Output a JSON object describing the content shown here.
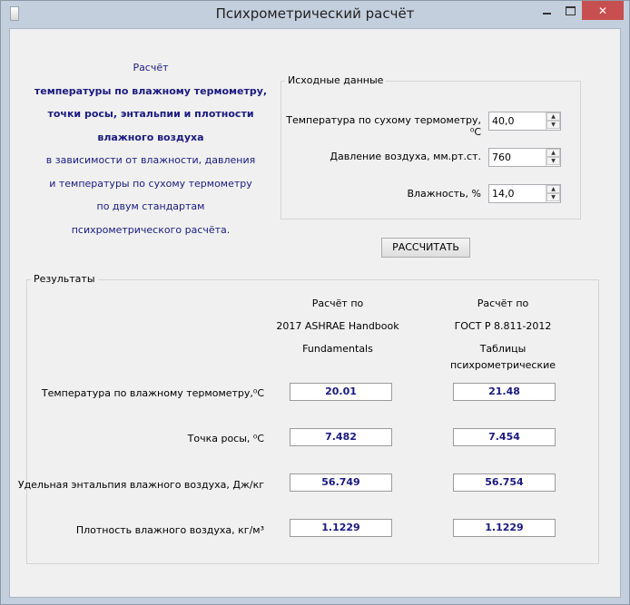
{
  "window": {
    "title": "Психрометрический расчёт"
  },
  "intro": {
    "line1": "Расчёт",
    "line2": "температуры по влажному термометру,",
    "line3": "точки росы, энтальпии и плотности",
    "line4": "влажного воздуха",
    "line5": "в зависимости от влажности, давления",
    "line6": "и температуры по сухому термометру",
    "line7": "по двум стандартам",
    "line8": "психрометрического расчёта."
  },
  "inputs": {
    "group_label": "Исходные данные",
    "dry_temp": {
      "label": "Температура по сухому термометру, ⁰С",
      "value": "40,0"
    },
    "pressure": {
      "label": "Давление воздуха, мм.рт.ст.",
      "value": "760"
    },
    "humidity": {
      "label": "Влажность, %",
      "value": "14,0"
    }
  },
  "calculate_button": "РАССЧИТАТЬ",
  "results": {
    "group_label": "Результаты",
    "col1": {
      "line1": "Расчёт по",
      "line2": "2017 ASHRAE Handbook",
      "line3": "Fundamentals"
    },
    "col2": {
      "line1": "Расчёт по",
      "line2": "ГОСТ Р 8.811-2012",
      "line3": "Таблицы психрометрические"
    },
    "rows": [
      {
        "label": "Температура по влажному термометру,⁰С",
        "ashrae": "20.01",
        "gost": "21.48"
      },
      {
        "label": "Точка росы, ⁰С",
        "ashrae": "7.482",
        "gost": "7.454"
      },
      {
        "label": "Удельная энтальпия влажного воздуха, Дж/кг",
        "ashrae": "56.749",
        "gost": "56.754"
      },
      {
        "label": "Плотность влажного воздуха, кг/м³",
        "ashrae": "1.1229",
        "gost": "1.1229"
      }
    ]
  }
}
